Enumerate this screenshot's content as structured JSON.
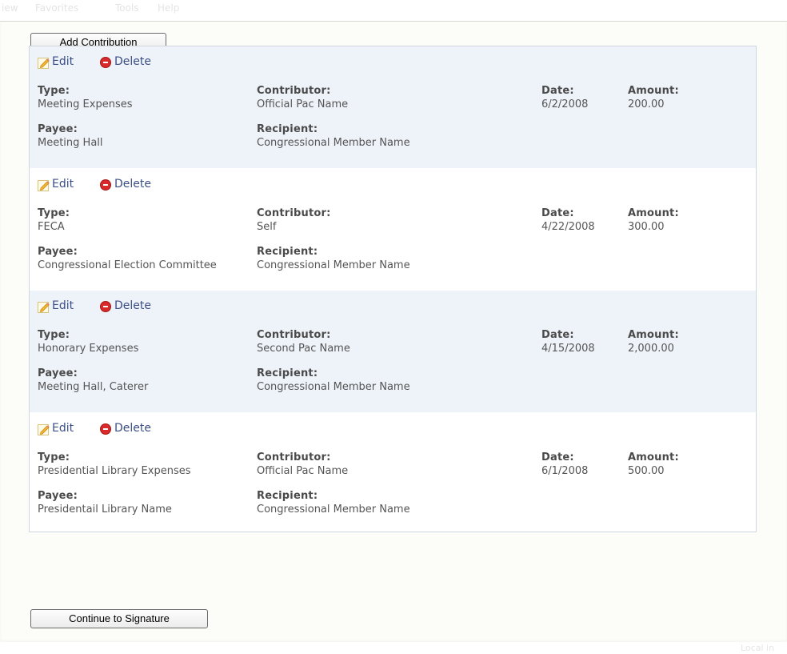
{
  "menubar": {
    "items": [
      "iew",
      "Favorites",
      "Tools",
      "Help"
    ]
  },
  "toolbar": {
    "add_label": "Add Contribution",
    "continue_label": "Continue to Signature"
  },
  "labels": {
    "type": "Type:",
    "contributor": "Contributor:",
    "date": "Date:",
    "amount": "Amount:",
    "payee": "Payee:",
    "recipient": "Recipient:",
    "edit": "Edit",
    "delete": "Delete"
  },
  "contributions": [
    {
      "type": "Meeting Expenses",
      "contributor": "Official Pac Name",
      "date": "6/2/2008",
      "amount": "200.00",
      "payee": "Meeting Hall",
      "recipient": "Congressional Member Name"
    },
    {
      "type": "FECA",
      "contributor": "Self",
      "date": "4/22/2008",
      "amount": "300.00",
      "payee": "Congressional Election Committee",
      "recipient": "Congressional Member Name"
    },
    {
      "type": "Honorary Expenses",
      "contributor": "Second Pac Name",
      "date": "4/15/2008",
      "amount": "2,000.00",
      "payee": "Meeting Hall, Caterer",
      "recipient": "Congressional Member Name"
    },
    {
      "type": "Presidential Library Expenses",
      "contributor": "Official Pac Name",
      "date": "6/1/2008",
      "amount": "500.00",
      "payee": "Presidentail Library Name",
      "recipient": "Congressional Member Name"
    }
  ],
  "statusbar": {
    "zone_text": "Local in"
  },
  "colors": {
    "row_alt": "#eef2f9",
    "link": "#3b4f86",
    "delete_icon": "#d82a2a"
  }
}
